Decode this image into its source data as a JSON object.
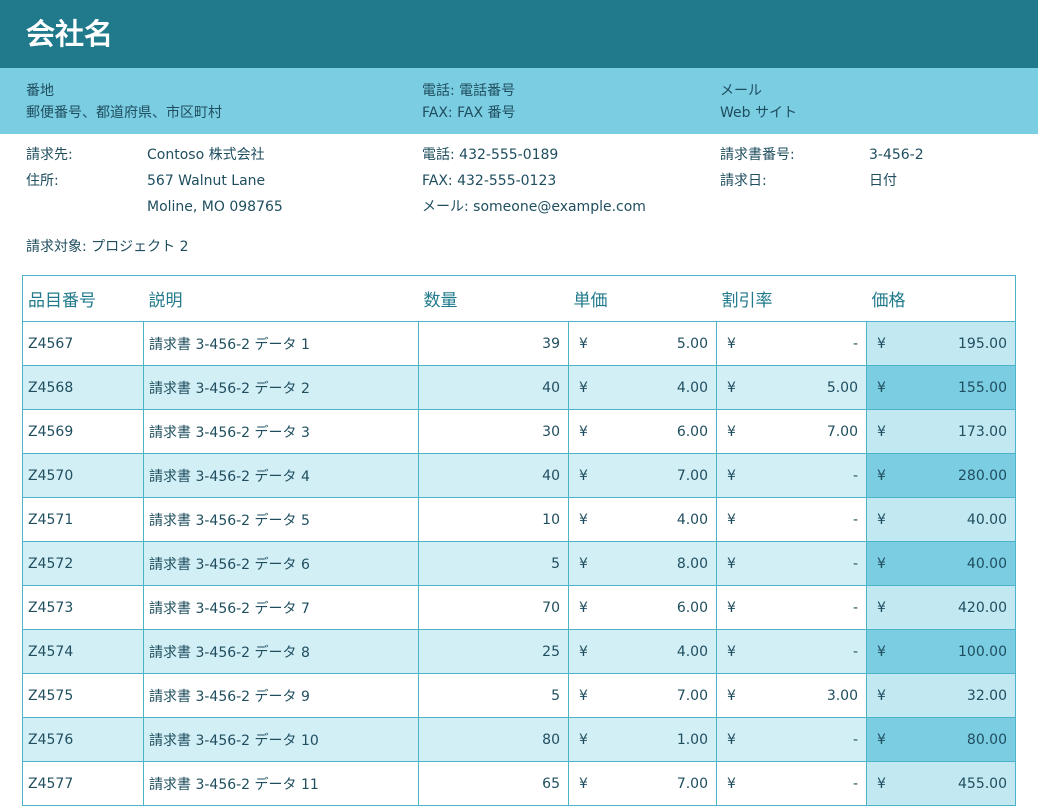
{
  "header": {
    "company_name": "会社名"
  },
  "info": {
    "address_label": "番地",
    "address_line": "郵便番号、都道府県、市区町村",
    "phone": "電話: 電話番号",
    "fax": "FAX: FAX 番号",
    "email": "メール",
    "website": "Web サイト"
  },
  "billing": {
    "bill_to_label": "請求先:",
    "bill_to_value": "Contoso 株式会社",
    "address_label": "住所:",
    "address_line1": "567 Walnut Lane",
    "address_line2": "Moline, MO 098765",
    "phone": "電話: 432-555-0189",
    "fax": "FAX: 432-555-0123",
    "email": "メール: someone@example.com",
    "invoice_no_label": "請求書番号:",
    "invoice_no_value": "3-456-2",
    "invoice_date_label": "請求日:",
    "invoice_date_value": "日付"
  },
  "project": "請求対象: プロジェクト 2",
  "table": {
    "headers": [
      "品目番号",
      "説明",
      "数量",
      "単価",
      "割引率",
      "価格"
    ],
    "currency": "¥",
    "rows": [
      {
        "item": "Z4567",
        "desc": "請求書 3-456-2 データ 1",
        "qty": "39",
        "unit": "5.00",
        "disc": "-",
        "price": "195.00"
      },
      {
        "item": "Z4568",
        "desc": "請求書 3-456-2 データ 2",
        "qty": "40",
        "unit": "4.00",
        "disc": "5.00",
        "price": "155.00"
      },
      {
        "item": "Z4569",
        "desc": "請求書 3-456-2 データ 3",
        "qty": "30",
        "unit": "6.00",
        "disc": "7.00",
        "price": "173.00"
      },
      {
        "item": "Z4570",
        "desc": "請求書 3-456-2 データ 4",
        "qty": "40",
        "unit": "7.00",
        "disc": "-",
        "price": "280.00"
      },
      {
        "item": "Z4571",
        "desc": "請求書 3-456-2 データ 5",
        "qty": "10",
        "unit": "4.00",
        "disc": "-",
        "price": "40.00"
      },
      {
        "item": "Z4572",
        "desc": "請求書 3-456-2 データ 6",
        "qty": "5",
        "unit": "8.00",
        "disc": "-",
        "price": "40.00"
      },
      {
        "item": "Z4573",
        "desc": "請求書 3-456-2 データ 7",
        "qty": "70",
        "unit": "6.00",
        "disc": "-",
        "price": "420.00"
      },
      {
        "item": "Z4574",
        "desc": "請求書 3-456-2 データ 8",
        "qty": "25",
        "unit": "4.00",
        "disc": "-",
        "price": "100.00"
      },
      {
        "item": "Z4575",
        "desc": "請求書 3-456-2 データ 9",
        "qty": "5",
        "unit": "7.00",
        "disc": "3.00",
        "price": "32.00"
      },
      {
        "item": "Z4576",
        "desc": "請求書 3-456-2 データ 10",
        "qty": "80",
        "unit": "1.00",
        "disc": "-",
        "price": "80.00"
      },
      {
        "item": "Z4577",
        "desc": "請求書 3-456-2 データ 11",
        "qty": "65",
        "unit": "7.00",
        "disc": "-",
        "price": "455.00"
      }
    ]
  }
}
